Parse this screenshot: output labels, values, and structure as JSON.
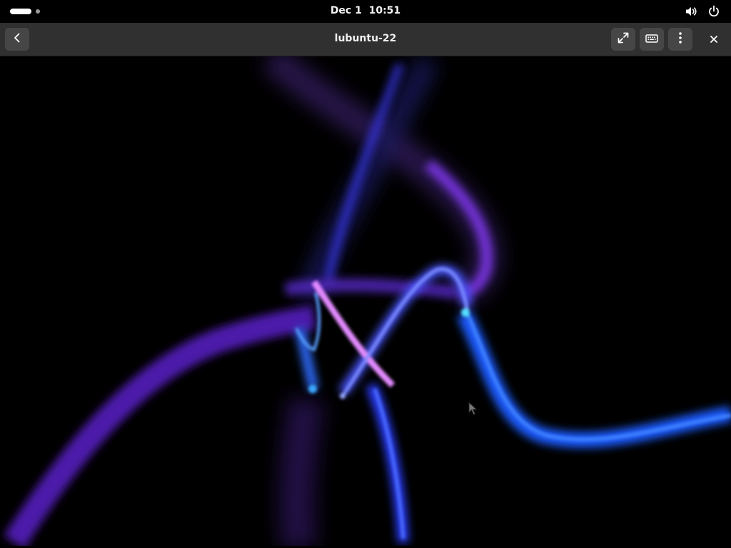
{
  "topbar": {
    "date": "Dec 1",
    "time": "10:51",
    "icons": [
      "workspace-indicator",
      "volume-icon",
      "power-icon"
    ]
  },
  "window": {
    "title": "lubuntu-22",
    "buttons": [
      "back-icon",
      "fullscreen-icon",
      "keyboard-icon",
      "menu-icon",
      "close-icon"
    ]
  },
  "colors": {
    "topbar_bg": "#000000",
    "headerbar_bg": "#303030",
    "button_bg": "#464646",
    "screensaver_blue": "#3b5bff",
    "screensaver_purple": "#7a3cff",
    "screensaver_pink": "#d86cff",
    "screensaver_cyan": "#2fc8ff"
  }
}
